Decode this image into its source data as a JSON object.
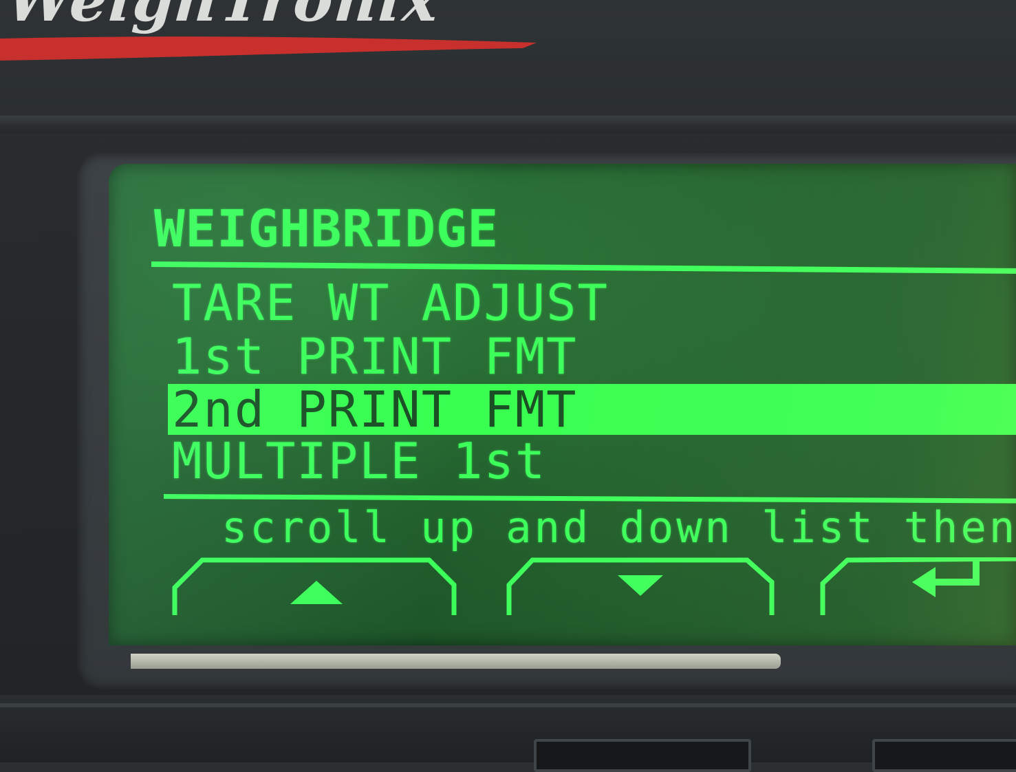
{
  "brand": {
    "logo_text": "WeighTronix",
    "stripe_color": "#c8302e"
  },
  "screen": {
    "title": "WEIGHBRIDGE",
    "menu_items": [
      {
        "label": "TARE WT ADJUST",
        "selected": false
      },
      {
        "label": "1st PRINT FMT",
        "selected": false
      },
      {
        "label": "2nd PRINT FMT",
        "selected": true
      },
      {
        "label": "MULTIPLE 1st",
        "selected": false
      }
    ],
    "hint": "scroll up and down list then",
    "softkeys": [
      {
        "name": "up",
        "icon": "up-triangle-icon"
      },
      {
        "name": "down",
        "icon": "down-triangle-icon"
      },
      {
        "name": "enter",
        "icon": "enter-arrow-icon"
      }
    ],
    "colors": {
      "lcd_text": "#3cff5a",
      "lcd_background": "#22602d",
      "highlight_bar": "#38ff50"
    }
  }
}
